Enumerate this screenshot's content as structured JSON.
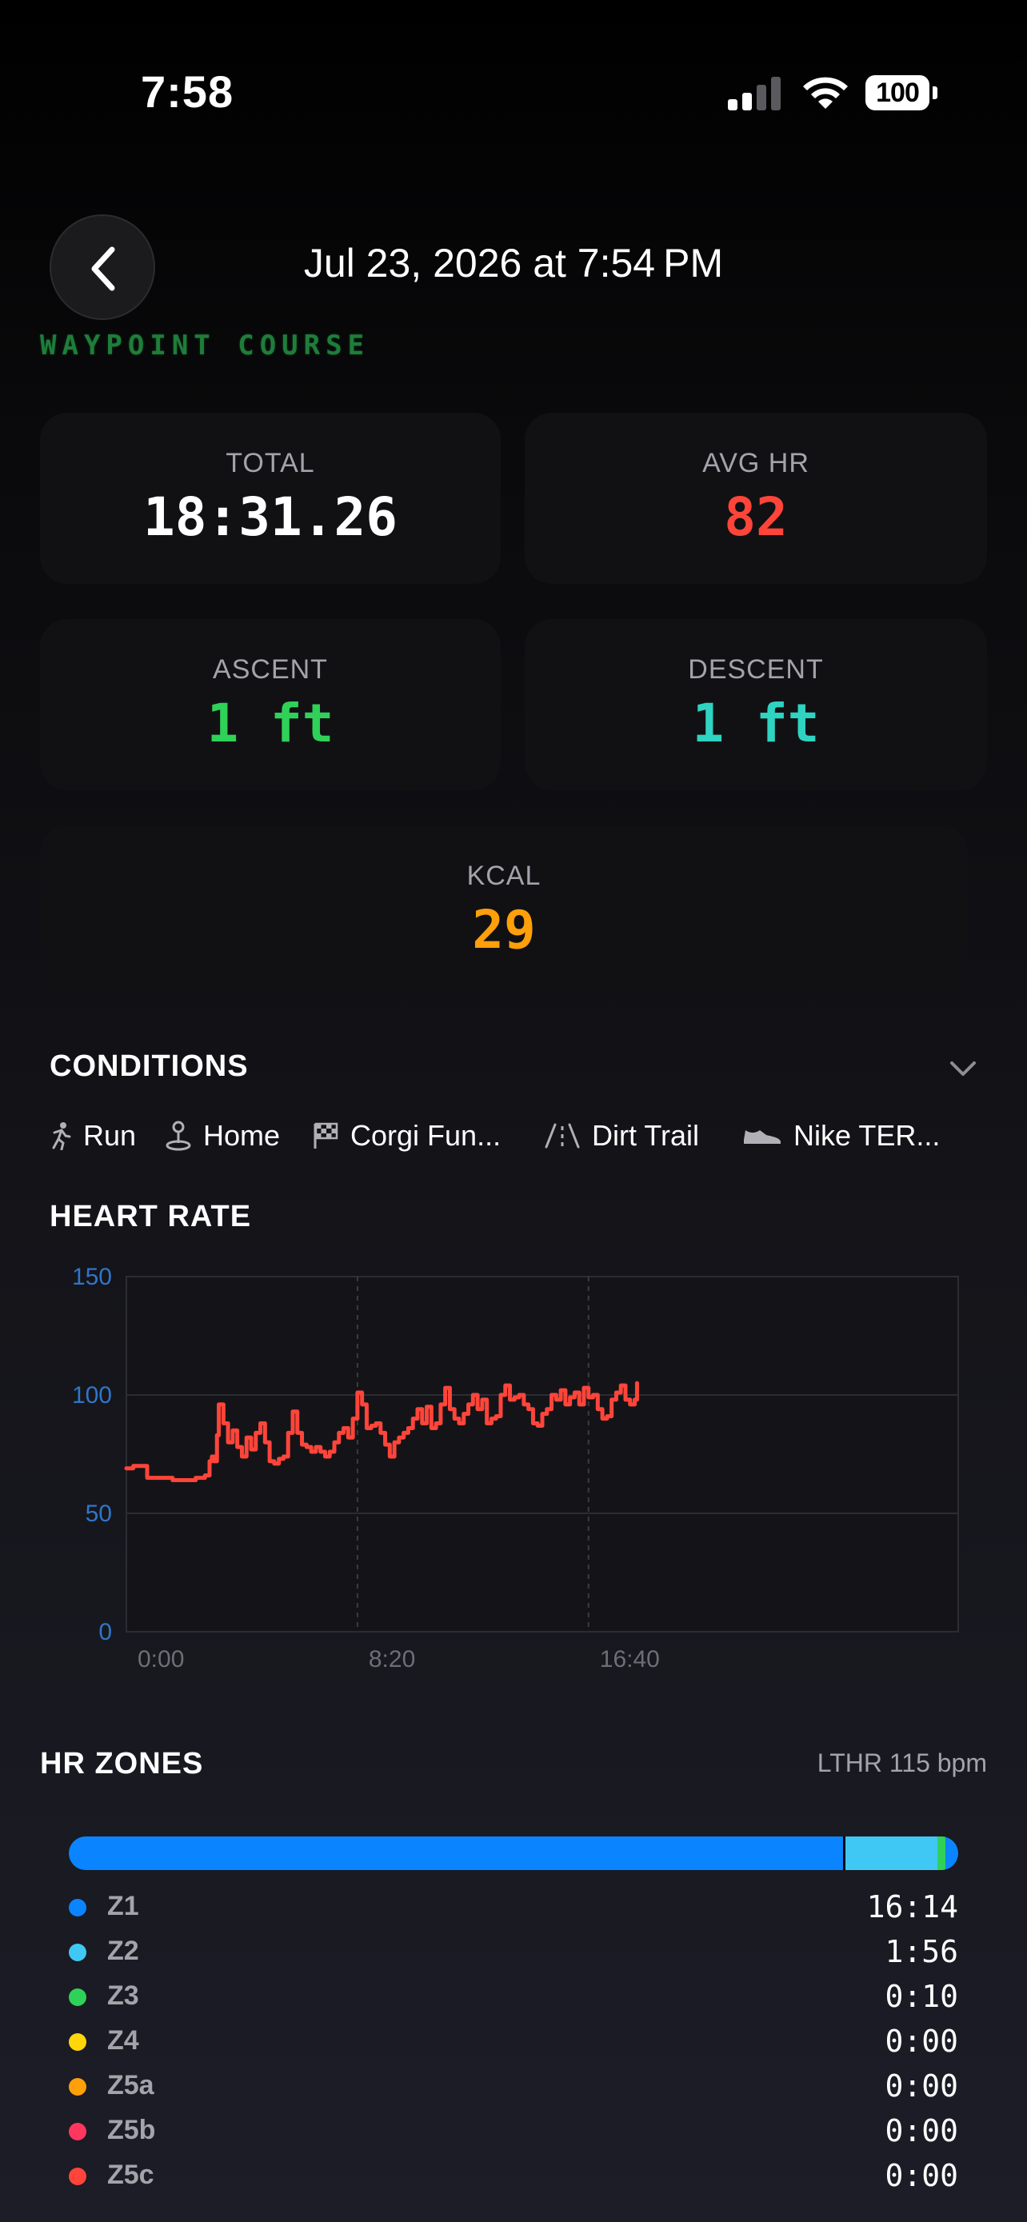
{
  "status_bar": {
    "time": "7:58",
    "battery": "100"
  },
  "header": {
    "title": "Jul 23, 2026 at 7:54 PM",
    "watermark": "WAYPOINT COURSE"
  },
  "stats": [
    {
      "label": "TOTAL",
      "value": "18:31.26",
      "color": "#ffffff"
    },
    {
      "label": "AVG HR",
      "value": "82",
      "color": "#ff453a"
    },
    {
      "label": "ASCENT",
      "value": "1 ft",
      "color": "#30d158"
    },
    {
      "label": "DESCENT",
      "value": "1 ft",
      "color": "#2ed3c1"
    },
    {
      "label": "KCAL",
      "value": "29",
      "color": "#ff9f0a"
    }
  ],
  "conditions": {
    "title": "CONDITIONS",
    "items": [
      {
        "icon": "running-person-icon",
        "label": "Run"
      },
      {
        "icon": "home-pin-icon",
        "label": "Home"
      },
      {
        "icon": "checkered-flag-icon",
        "label": "Corgi Fun..."
      },
      {
        "icon": "trail-icon",
        "label": "Dirt Trail"
      },
      {
        "icon": "shoe-icon",
        "label": "Nike TER..."
      }
    ]
  },
  "heart_rate": {
    "title": "HEART RATE"
  },
  "chart_data": {
    "type": "line",
    "title": "",
    "xlabel": "",
    "ylabel": "",
    "xlim": [
      0,
      1800
    ],
    "ylim": [
      0,
      150
    ],
    "y_ticks": [
      "0",
      "50",
      "100",
      "150"
    ],
    "x_ticks": [
      "0:00",
      "8:20",
      "16:40"
    ],
    "x_tick_values": [
      0,
      500,
      1000
    ],
    "grid": true,
    "line_color": "#ff453a",
    "series": [
      {
        "x": [
          0,
          15,
          40,
          45,
          70,
          100,
          120,
          150,
          165,
          170,
          180,
          185,
          190,
          196,
          200,
          210,
          220,
          230,
          240,
          250,
          260,
          270,
          280,
          290,
          300,
          310,
          320,
          330,
          340,
          350,
          360,
          370,
          380,
          390,
          400,
          410,
          420,
          430,
          440,
          450,
          460,
          470,
          480,
          490,
          500,
          510,
          520,
          530,
          540,
          550,
          560,
          570,
          580,
          590,
          600,
          610,
          620,
          630,
          640,
          650,
          660,
          670,
          680,
          690,
          700,
          710,
          720,
          730,
          740,
          750,
          760,
          770,
          780,
          790,
          800,
          810,
          820,
          830,
          840,
          850,
          860,
          870,
          880,
          890,
          900,
          910,
          920,
          930,
          940,
          950,
          960,
          970,
          980,
          990,
          1000,
          1010,
          1020,
          1030,
          1040,
          1050,
          1060,
          1070,
          1080,
          1090,
          1100,
          1105
        ],
        "y": [
          69,
          70,
          70,
          65,
          65,
          64,
          64,
          65,
          65,
          66,
          72,
          74,
          72,
          83,
          96,
          88,
          80,
          85,
          78,
          74,
          82,
          77,
          84,
          88,
          80,
          72,
          71,
          73,
          74,
          84,
          93,
          84,
          79,
          78,
          76,
          78,
          76,
          74,
          76,
          80,
          84,
          86,
          82,
          90,
          101,
          96,
          86,
          87,
          88,
          84,
          79,
          74,
          80,
          82,
          84,
          86,
          90,
          94,
          88,
          95,
          86,
          88,
          96,
          103,
          94,
          90,
          88,
          92,
          96,
          100,
          94,
          98,
          88,
          90,
          91,
          100,
          104,
          98,
          99,
          100,
          96,
          94,
          88,
          87,
          92,
          94,
          100,
          98,
          102,
          96,
          99,
          101,
          96,
          103,
          99,
          100,
          94,
          90,
          91,
          98,
          101,
          104,
          98,
          96,
          98,
          105
        ]
      }
    ]
  },
  "hr_zones": {
    "title": "HR ZONES",
    "lthr": "LTHR 115 bpm",
    "distribution": {
      "z1": 0.872,
      "z2": 0.104,
      "z3": 0.009
    },
    "zones": [
      {
        "name": "Z1",
        "time": "16:14",
        "color": "#0a84ff"
      },
      {
        "name": "Z2",
        "time": "1:56",
        "color": "#40c8f4"
      },
      {
        "name": "Z3",
        "time": "0:10",
        "color": "#30d158"
      },
      {
        "name": "Z4",
        "time": "0:00",
        "color": "#ffd60a"
      },
      {
        "name": "Z5a",
        "time": "0:00",
        "color": "#ff9f0a"
      },
      {
        "name": "Z5b",
        "time": "0:00",
        "color": "#ff375f"
      },
      {
        "name": "Z5c",
        "time": "0:00",
        "color": "#ff453a"
      }
    ]
  }
}
